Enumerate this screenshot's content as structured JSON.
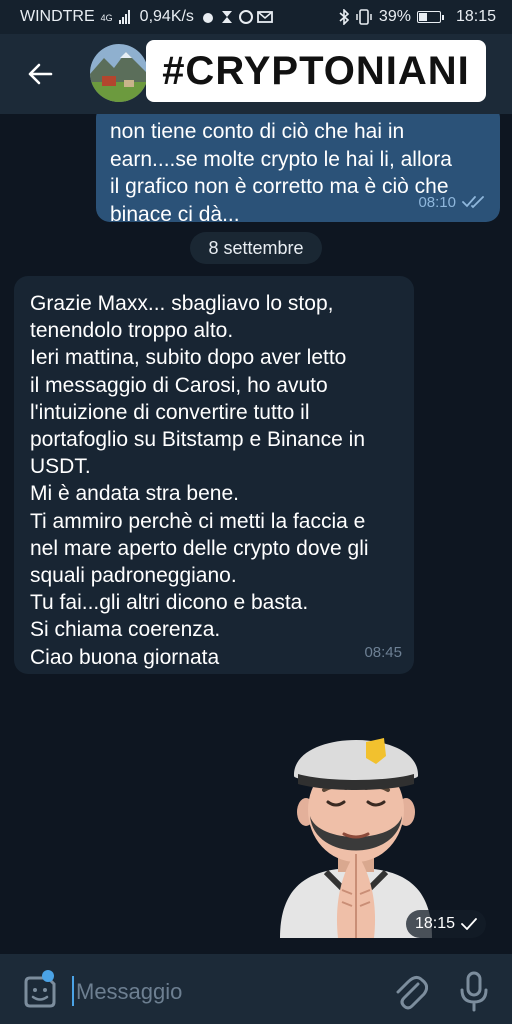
{
  "status_bar": {
    "carrier": "WINDTRE",
    "network": "4G",
    "speed": "0,94K/s",
    "battery": "39%",
    "battery_level": 0.39,
    "time": "18:15"
  },
  "header": {
    "channel_name": "#CRYPTONIANI",
    "back_icon": "arrow-left-icon"
  },
  "messages": {
    "outgoing": {
      "text": "non tiene conto di ciò che hai in\nearn....se molte crypto le hai li, allora\nil grafico non è corretto ma è ciò che\nbinace ci dà...",
      "time": "08:10"
    },
    "date_separator": "8 settembre",
    "incoming": {
      "text": "Grazie Maxx... sbagliavo lo stop,\ntenendolo troppo alto.\nIeri mattina, subito dopo aver letto\nil messaggio di Carosi, ho avuto\nl'intuizione di convertire tutto il\nportafoglio su Bitstamp e Binance in\nUSDT.\nMi è andata stra bene.\nTi ammiro perchè ci metti la faccia e\nnel mare aperto delle crypto dove gli\nsquali padroneggiano.\nTu fai...gli altri dicono e basta.\nSi chiama coerenza.\nCiao buona giornata",
      "time": "08:45"
    },
    "sticker": {
      "icon": "memoji-praying-sticker",
      "time": "18:15"
    }
  },
  "composer": {
    "placeholder": "Messaggio"
  },
  "colors": {
    "outgoing_bubble": "#2b5278",
    "incoming_bubble": "#182533",
    "chat_background": "#0e1621",
    "accent": "#4ba3e6"
  }
}
